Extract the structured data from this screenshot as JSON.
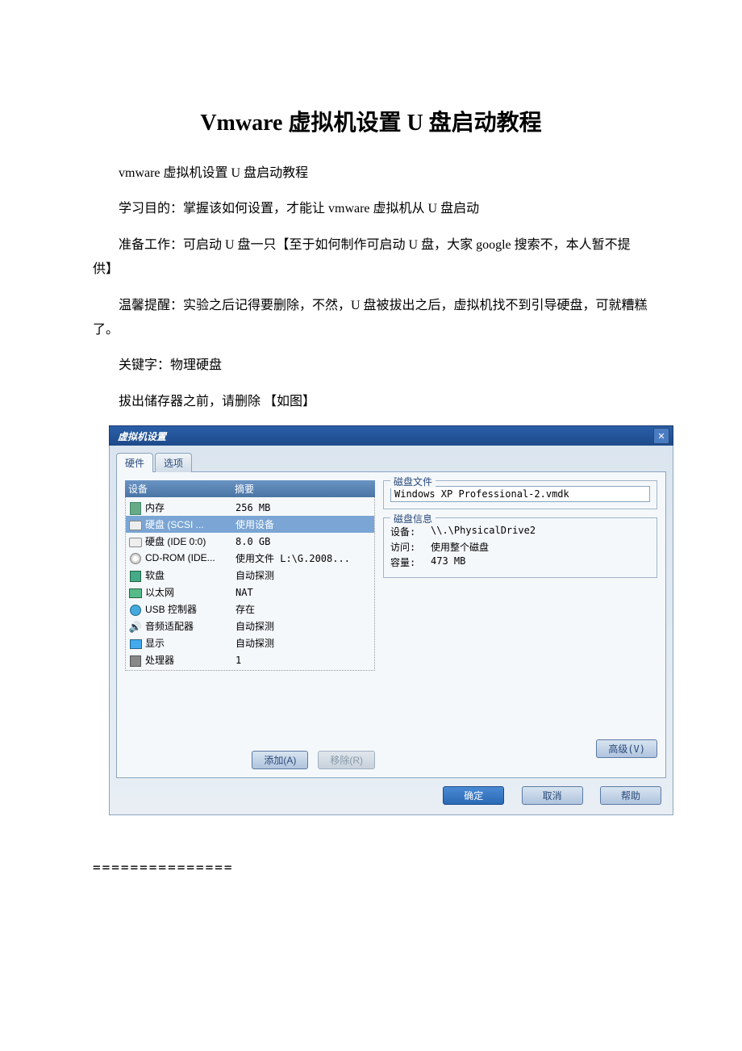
{
  "article": {
    "title": "Vmware 虚拟机设置 U 盘启动教程",
    "p1": "vmware 虚拟机设置 U 盘启动教程",
    "p2": "学习目的：掌握该如何设置，才能让 vmware 虚拟机从 U 盘启动",
    "p3": "准备工作：可启动 U 盘一只【至于如何制作可启动 U 盘，大家 google 搜索不，本人暂不提供】",
    "p4": "温馨提醒：实验之后记得要删除，不然，U 盘被拔出之后，虚拟机找不到引导硬盘，可就糟糕了。",
    "p5": "关键字：物理硬盘",
    "p6": "拔出储存器之前，请删除 【如图】",
    "separator": "==============="
  },
  "vm": {
    "title": "虚拟机设置",
    "tabs": {
      "hw": "硬件",
      "opt": "选项"
    },
    "cols": {
      "device": "设备",
      "summary": "摘要"
    },
    "rows": [
      {
        "icon": "memory-icon",
        "dev": "内存",
        "sum": "256 MB"
      },
      {
        "icon": "disk-icon",
        "dev": "硬盘 (SCSI ...",
        "sum": "使用设备",
        "selected": true
      },
      {
        "icon": "disk-icon",
        "dev": "硬盘 (IDE 0:0)",
        "sum": "8.0 GB"
      },
      {
        "icon": "cdrom-icon",
        "dev": "CD-ROM (IDE...",
        "sum": "使用文件 L:\\G.2008..."
      },
      {
        "icon": "floppy-icon",
        "dev": "软盘",
        "sum": "自动探测"
      },
      {
        "icon": "ethernet-icon",
        "dev": "以太网",
        "sum": "NAT"
      },
      {
        "icon": "usb-icon",
        "dev": "USB 控制器",
        "sum": "存在"
      },
      {
        "icon": "sound-icon",
        "dev": "音频适配器",
        "sum": "自动探测"
      },
      {
        "icon": "display-icon",
        "dev": "显示",
        "sum": "自动探测"
      },
      {
        "icon": "cpu-icon",
        "dev": "处理器",
        "sum": "1"
      }
    ],
    "buttons": {
      "add": "添加(A)",
      "remove": "移除(R)",
      "advanced": "高级(V)",
      "ok": "确定",
      "cancel": "取消",
      "help": "帮助"
    },
    "right": {
      "diskfile_label": "磁盘文件",
      "diskfile_value": "Windows XP Professional-2.vmdk",
      "diskinfo_label": "磁盘信息",
      "info_device_k": "设备:",
      "info_device_v": "\\\\.\\PhysicalDrive2",
      "info_access_k": "访问:",
      "info_access_v": "使用整个磁盘",
      "info_cap_k": "容量:",
      "info_cap_v": "473 MB"
    }
  }
}
